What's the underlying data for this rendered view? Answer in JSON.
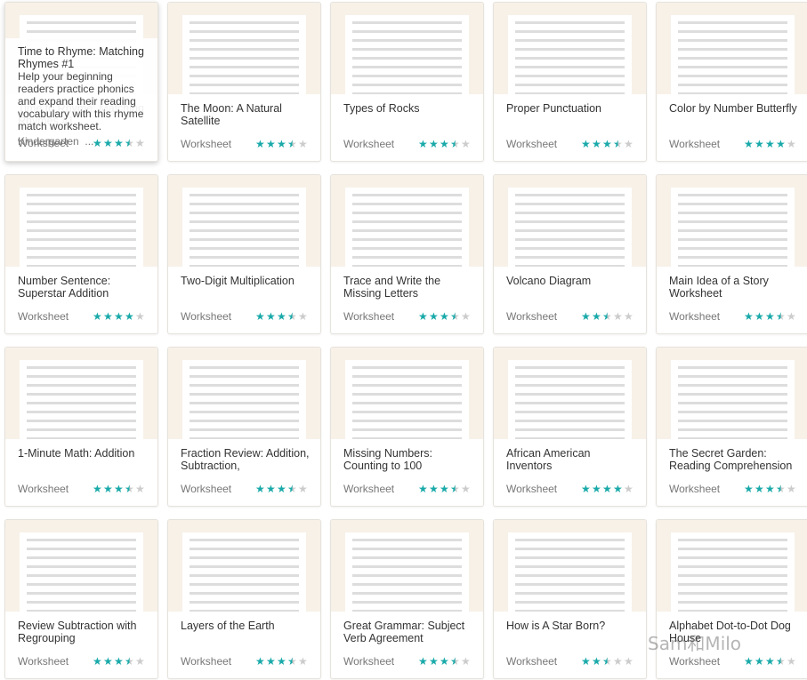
{
  "accent": "#1aa9a9",
  "hover_card": {
    "title": "Time to Rhyme: Matching Rhymes #1",
    "description": "Help your beginning readers practice phonics and expand their reading vocabulary with this rhyme match worksheet.",
    "grade": "Kindergarten",
    "more": "..."
  },
  "cards": [
    {
      "title": "Time to Rhyme: Matching Rhymes #1",
      "type": "Worksheet",
      "rating": 3.5
    },
    {
      "title": "The Moon: A Natural Satellite",
      "type": "Worksheet",
      "rating": 3.5
    },
    {
      "title": "Types of Rocks",
      "type": "Worksheet",
      "rating": 3.5
    },
    {
      "title": "Proper Punctuation",
      "type": "Worksheet",
      "rating": 3.5
    },
    {
      "title": "Color by Number Butterfly",
      "type": "Worksheet",
      "rating": 4
    },
    {
      "title": "Number Sentence: Superstar Addition",
      "type": "Worksheet",
      "rating": 4
    },
    {
      "title": "Two-Digit Multiplication",
      "type": "Worksheet",
      "rating": 3.5
    },
    {
      "title": "Trace and Write the Missing Letters",
      "type": "Worksheet",
      "rating": 3.5
    },
    {
      "title": "Volcano Diagram",
      "type": "Worksheet",
      "rating": 2.5
    },
    {
      "title": "Main Idea of a Story Worksheet",
      "type": "Worksheet",
      "rating": 3.5
    },
    {
      "title": "1-Minute Math: Addition",
      "type": "Worksheet",
      "rating": 3.5
    },
    {
      "title": "Fraction Review: Addition, Subtraction,",
      "type": "Worksheet",
      "rating": 3.5
    },
    {
      "title": "Missing Numbers: Counting to 100",
      "type": "Worksheet",
      "rating": 3.5
    },
    {
      "title": "African American Inventors",
      "type": "Worksheet",
      "rating": 4
    },
    {
      "title": "The Secret Garden: Reading Comprehension",
      "type": "Worksheet",
      "rating": 3.5
    },
    {
      "title": "Review Subtraction with Regrouping",
      "type": "Worksheet",
      "rating": 3.5
    },
    {
      "title": "Layers of the Earth",
      "type": "Worksheet",
      "rating": 3.5
    },
    {
      "title": "Great Grammar: Subject Verb Agreement",
      "type": "Worksheet",
      "rating": 3.5
    },
    {
      "title": "How is A Star Born?",
      "type": "Worksheet",
      "rating": 2.5
    },
    {
      "title": "Alphabet Dot-to-Dot Dog House",
      "type": "Worksheet",
      "rating": 3.5
    }
  ],
  "watermark": "Sam和Milo"
}
